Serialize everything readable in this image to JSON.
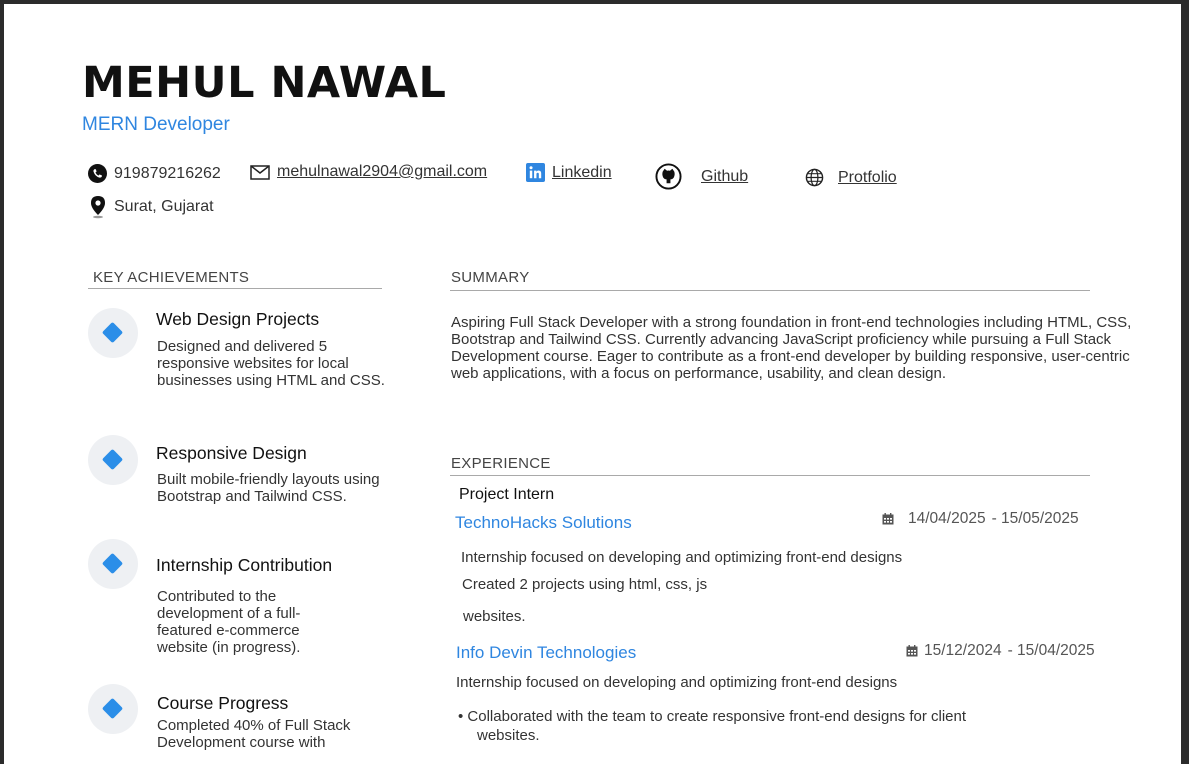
{
  "header": {
    "name": "MEHUL NAWAL",
    "role": "MERN Developer"
  },
  "contact": {
    "phone": "919879216262",
    "email": "mehulnawal2904@gmail.com",
    "linkedin": "Linkedin",
    "github": "Github",
    "portfolio": "Protfolio",
    "location": "Surat, Gujarat"
  },
  "achievements": {
    "heading": "KEY ACHIEVEMENTS",
    "items": [
      {
        "title": "Web Design Projects",
        "text": "Designed and delivered 5 responsive websites for local businesses using HTML and CSS."
      },
      {
        "title": "Responsive Design",
        "text": "Built mobile-friendly layouts using Bootstrap and Tailwind CSS."
      },
      {
        "title": "Internship Contribution",
        "text": "Contributed to the development of a full-featured e-commerce website (in progress)."
      },
      {
        "title": "Course Progress",
        "text": "Completed 40% of Full Stack Development course with"
      }
    ]
  },
  "summary": {
    "heading": "SUMMARY",
    "text": "Aspiring Full Stack Developer with a strong foundation in front-end technologies including HTML, CSS, Bootstrap and Tailwind CSS. Currently advancing JavaScript proficiency while pursuing a Full Stack Development course. Eager to contribute as a front-end developer by building responsive, user-centric web applications, with a focus on performance, usability, and clean design."
  },
  "experience": {
    "heading": "EXPERIENCE",
    "jobs": [
      {
        "position": "Project Intern",
        "company": "TechnoHacks Solutions",
        "start": "14/04/2025",
        "end": "- 15/05/2025",
        "lines": [
          "Internship focused on developing and optimizing front-end designs",
          "Created 2 projects using html, css, js",
          "websites."
        ]
      },
      {
        "company": "Info Devin Technologies",
        "start": "15/12/2024",
        "end": "- 15/04/2025",
        "description": "Internship focused on developing and optimizing front-end designs",
        "bullets": [
          "Collaborated with the team to create responsive front-end designs for client",
          "websites."
        ]
      }
    ]
  },
  "colors": {
    "accent": "#2f86e0",
    "diamond": "#2b8ee8"
  },
  "icons": [
    "phone-icon",
    "mail-icon",
    "linkedin-icon",
    "github-icon",
    "globe-icon",
    "location-pin-icon",
    "calendar-icon",
    "diamond-icon"
  ]
}
